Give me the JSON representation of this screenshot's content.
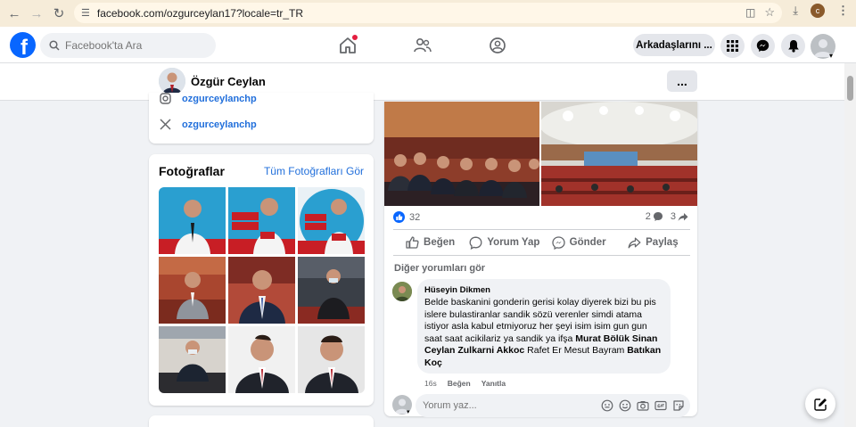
{
  "browser": {
    "url": "facebook.com/ozgurceylan17?locale=tr_TR",
    "profile_initial": "c"
  },
  "fbnav": {
    "search_placeholder": "Facebook'ta Ara",
    "friends_button": "Arkadaşlarını ..."
  },
  "profile": {
    "name": "Özgür Ceylan",
    "more_label": "..."
  },
  "intro": {
    "instagram_handle": "ozgurceylanchp",
    "x_handle": "ozgurceylanchp"
  },
  "photos": {
    "title": "Fotoğraflar",
    "all_link": "Tüm Fotoğrafları Gör"
  },
  "post": {
    "reaction_count": "32",
    "comment_count": "2",
    "share_count": "3",
    "actions": {
      "like": "Beğen",
      "comment": "Yorum Yap",
      "send": "Gönder",
      "share": "Paylaş"
    },
    "more_comments": "Diğer yorumları gör",
    "comment": {
      "author": "Hüseyin Dikmen",
      "text": "Belde baskanini gonderin gerisi kolay diyerek bizi bu pis islere bulastiranlar sandik sözü verenler simdi atama istiyor asla kabul etmiyoruz her şeyi isim isim gun gun saat saat acikilariz ya sandik ya ifşa",
      "tags": [
        "Murat Bölük",
        "Sinan Ceylan",
        "Zulkarni Akkoc"
      ],
      "plain_tail": "Rafet Er Mesut Bayram",
      "tag_last": "Batıkan Koç",
      "time": "16s",
      "like_label": "Beğen",
      "reply_label": "Yanıtla"
    },
    "write_placeholder": "Yorum yaz..."
  },
  "colors": {
    "fb_blue": "#0866ff",
    "link_blue": "#216fdb",
    "page_bg": "#f0f2f5",
    "chrome_bg": "#f6ecd9"
  }
}
